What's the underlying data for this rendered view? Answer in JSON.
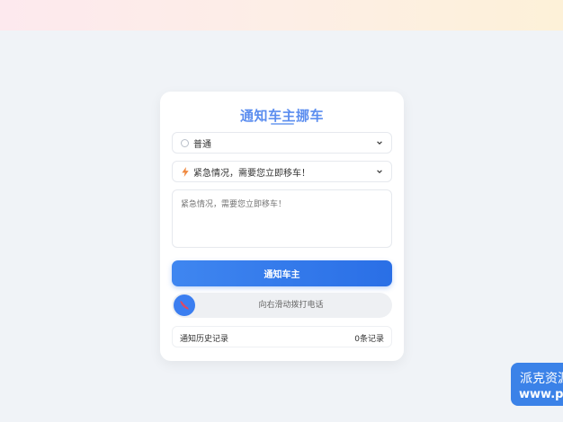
{
  "card": {
    "title": "通知车主挪车",
    "priority_select": {
      "value": "普通"
    },
    "message_select": {
      "value": "紧急情况，需要您立即移车！"
    },
    "message_textarea": {
      "placeholder": "紧急情况，需要您立即移车！"
    },
    "notify_button": "通知车主",
    "call_slider": {
      "text": "向右滑动拨打电话"
    },
    "history": {
      "label": "通知历史记录",
      "count": "0条记录"
    }
  },
  "watermark": {
    "line1": "派克资源",
    "line2": "www.pk"
  },
  "icons": {
    "priority": "radio-circle-icon",
    "message": "lightning-bolt-icon",
    "dropdown": "chevron-down-icon",
    "slider": "phone-icon"
  },
  "colors": {
    "accent": "#3b7ef0",
    "title": "#5b8def",
    "bolt": "#f0883e",
    "phone": "#e8465b"
  }
}
